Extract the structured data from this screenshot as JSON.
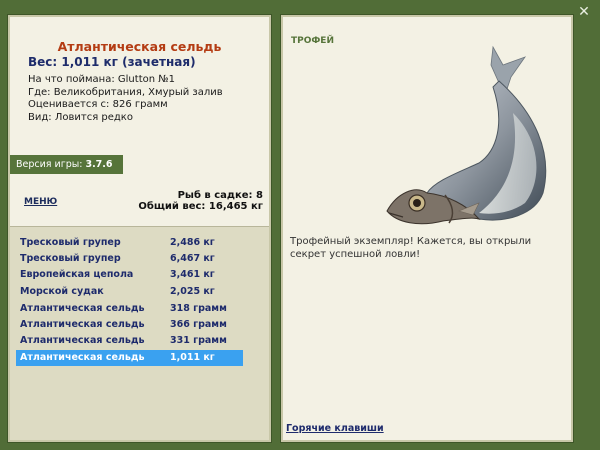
{
  "close_icon": "close-icon",
  "fish": {
    "title": "Атлантическая сельдь",
    "weight_line": "Вес: 1,011 кг (зачетная)",
    "caught_with_label": "На что поймана:",
    "caught_with": "Glutton №1",
    "location_label": "Где:",
    "location": "Великобритания, Хмурый залив",
    "value_label": "Оценивается с:",
    "value": "826 грамм",
    "kind_label": "Вид:",
    "kind": "Ловится редко"
  },
  "version": {
    "label": "Версия игры:",
    "number": "3.7.6"
  },
  "menu_label": "МЕНЮ",
  "cage": {
    "count_label": "Рыб в садке:",
    "count": "8",
    "total_label": "Общий вес:",
    "total": "16,465 кг"
  },
  "catch_list": [
    {
      "name": "Тресковый групер",
      "weight": "2,486 кг"
    },
    {
      "name": "Тресковый групер",
      "weight": "6,467 кг"
    },
    {
      "name": "Европейская цепола",
      "weight": "3,461 кг"
    },
    {
      "name": "Морской судак",
      "weight": "2,025 кг"
    },
    {
      "name": "Атлантическая сельдь",
      "weight": "318 грамм"
    },
    {
      "name": "Атлантическая сельдь",
      "weight": "366 грамм"
    },
    {
      "name": "Атлантическая сельдь",
      "weight": "331 грамм"
    },
    {
      "name": "Атлантическая сельдь",
      "weight": "1,011 кг"
    }
  ],
  "selected_index": 7,
  "trophy": {
    "label": "ТРОФЕЙ",
    "message": "Трофейный экземпляр! Кажется, вы открыли секрет успешной ловли!"
  },
  "hotkeys_label": "Горячие клавиши",
  "colors": {
    "frame": "#516d37",
    "panel": "#f3f1e4",
    "title": "#b43c13",
    "list_text": "#1e2b6c",
    "selection": "#3aa1f0"
  }
}
